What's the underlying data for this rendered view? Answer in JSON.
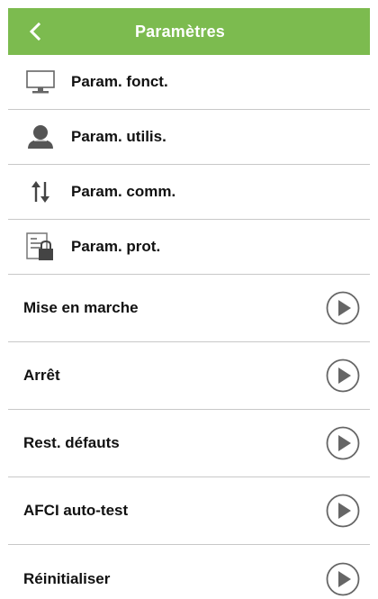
{
  "header": {
    "title": "Paramètres",
    "background_color": "#7cbb4f",
    "back_icon": "chevron-left-icon"
  },
  "settings_items": [
    {
      "label": "Param. fonct.",
      "icon": "monitor-icon"
    },
    {
      "label": "Param. utilis.",
      "icon": "user-icon"
    },
    {
      "label": "Param. comm.",
      "icon": "arrows-updown-icon"
    },
    {
      "label": "Param. prot.",
      "icon": "locked-document-icon"
    }
  ],
  "action_items": [
    {
      "label": "Mise en marche",
      "icon": "play-circle-icon"
    },
    {
      "label": "Arrêt",
      "icon": "play-circle-icon"
    },
    {
      "label": "Rest. défauts",
      "icon": "play-circle-icon"
    },
    {
      "label": "AFCI auto-test",
      "icon": "play-circle-icon"
    },
    {
      "label": "Réinitialiser",
      "icon": "play-circle-icon"
    }
  ]
}
